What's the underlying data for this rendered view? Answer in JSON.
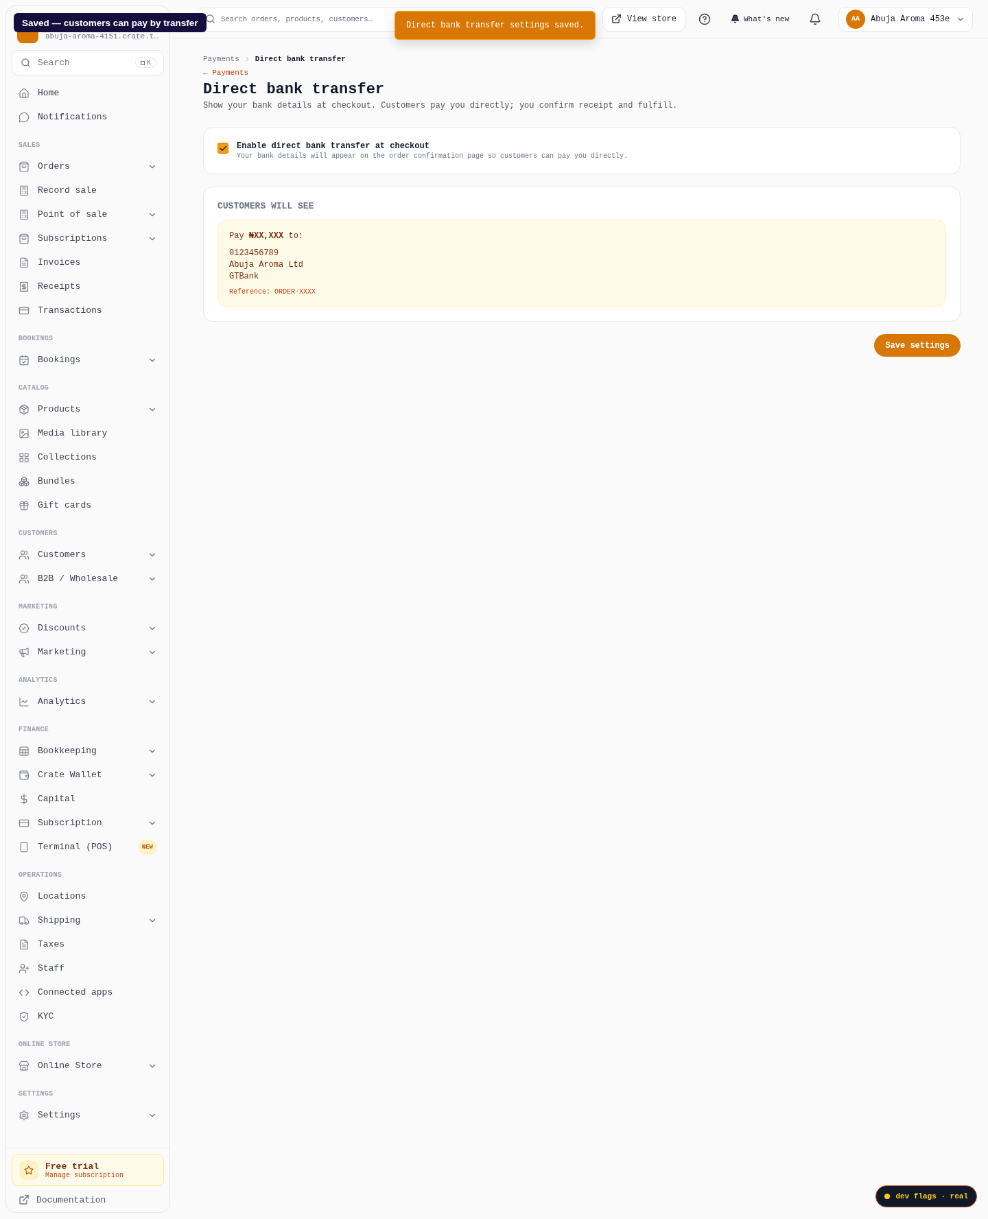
{
  "tooltip": "Saved — customers can pay by transfer",
  "store": {
    "subtitle": "abuja-aroma-4151.crate.t…"
  },
  "sidebar": {
    "search": {
      "placeholder": "Search",
      "shortcut": "K"
    },
    "sections": [
      {
        "items": [
          {
            "label": "Home",
            "has_submenu": false
          },
          {
            "label": "Notifications",
            "has_submenu": false
          }
        ]
      },
      {
        "title": "SALES",
        "items": [
          {
            "label": "Orders",
            "has_submenu": true
          },
          {
            "label": "Record sale",
            "has_submenu": false
          },
          {
            "label": "Point of sale",
            "has_submenu": true
          },
          {
            "label": "Subscriptions",
            "has_submenu": true
          },
          {
            "label": "Invoices",
            "has_submenu": false
          },
          {
            "label": "Receipts",
            "has_submenu": false
          },
          {
            "label": "Transactions",
            "has_submenu": false
          }
        ]
      },
      {
        "title": "BOOKINGS",
        "items": [
          {
            "label": "Bookings",
            "has_submenu": true
          }
        ]
      },
      {
        "title": "CATALOG",
        "items": [
          {
            "label": "Products",
            "has_submenu": true
          },
          {
            "label": "Media library",
            "has_submenu": false
          },
          {
            "label": "Collections",
            "has_submenu": false
          },
          {
            "label": "Bundles",
            "has_submenu": false
          },
          {
            "label": "Gift cards",
            "has_submenu": false
          }
        ]
      },
      {
        "title": "CUSTOMERS",
        "items": [
          {
            "label": "Customers",
            "has_submenu": true
          },
          {
            "label": "B2B / Wholesale",
            "has_submenu": true
          }
        ]
      },
      {
        "title": "MARKETING",
        "items": [
          {
            "label": "Discounts",
            "has_submenu": true
          },
          {
            "label": "Marketing",
            "has_submenu": true
          }
        ]
      },
      {
        "title": "ANALYTICS",
        "items": [
          {
            "label": "Analytics",
            "has_submenu": true
          }
        ]
      },
      {
        "title": "FINANCE",
        "items": [
          {
            "label": "Bookkeeping",
            "has_submenu": true
          },
          {
            "label": "Crate Wallet",
            "has_submenu": true
          },
          {
            "label": "Capital",
            "has_submenu": false
          },
          {
            "label": "Subscription",
            "has_submenu": true
          },
          {
            "label": "Terminal (POS)",
            "has_submenu": false,
            "badge": "NEW"
          }
        ]
      },
      {
        "title": "OPERATIONS",
        "items": [
          {
            "label": "Locations",
            "has_submenu": false
          },
          {
            "label": "Shipping",
            "has_submenu": true
          },
          {
            "label": "Taxes",
            "has_submenu": false
          },
          {
            "label": "Staff",
            "has_submenu": false
          },
          {
            "label": "Connected apps",
            "has_submenu": false
          },
          {
            "label": "KYC",
            "has_submenu": false
          }
        ]
      },
      {
        "title": "ONLINE STORE",
        "items": [
          {
            "label": "Online Store",
            "has_submenu": true
          }
        ]
      },
      {
        "title": "SETTINGS",
        "items": [
          {
            "label": "Settings",
            "has_submenu": true
          }
        ]
      }
    ],
    "trial": {
      "title": "Free trial",
      "subtitle": "Manage subscription"
    },
    "documentation": "Documentation"
  },
  "topbar": {
    "search": {
      "placeholder": "Search orders, products, customers…"
    },
    "view_store": "View store",
    "whats_new": "What's new",
    "account": {
      "initials": "AA",
      "name": "Abuja Aroma 453e"
    }
  },
  "toast": "Direct bank transfer settings saved.",
  "breadcrumb": [
    {
      "label": "Payments",
      "current": false
    },
    {
      "label": "Direct bank transfer",
      "current": true
    }
  ],
  "back_link": "← Payments",
  "title": "Direct bank transfer",
  "description": "Show your bank details at checkout. Customers pay you directly; you confirm receipt and fulfill.",
  "enable": {
    "checked": true,
    "label": "Enable direct bank transfer at checkout",
    "hint": "Your bank details will appear on the order confirmation page so customers can pay you directly."
  },
  "preview": {
    "heading": "CUSTOMERS WILL SEE",
    "pay_line": "Pay **₦XX,XXX** to:",
    "lines": [
      "0123456789",
      "Abuja Aroma Ltd",
      "GTBank"
    ],
    "reference": "Reference: ORDER-XXXX"
  },
  "save_button": "Save settings",
  "dev_flags": "dev flags · real"
}
